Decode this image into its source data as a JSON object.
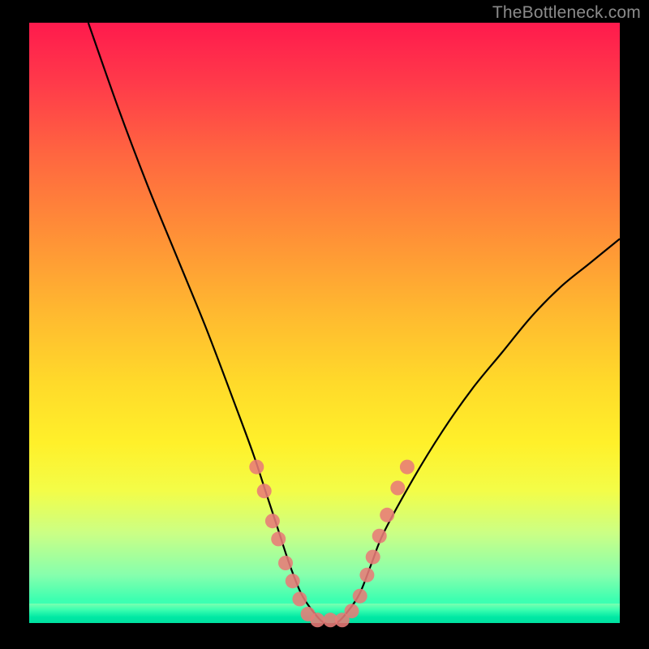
{
  "watermark": "TheBottleneck.com",
  "chart_data": {
    "type": "line",
    "title": "",
    "xlabel": "",
    "ylabel": "",
    "xlim": [
      0,
      100
    ],
    "ylim": [
      0,
      100
    ],
    "series": [
      {
        "name": "curve",
        "x": [
          10,
          15,
          20,
          25,
          30,
          35,
          38,
          40,
          42,
          44,
          46,
          48,
          50,
          52,
          54,
          56,
          58,
          60,
          65,
          70,
          75,
          80,
          85,
          90,
          95,
          100
        ],
        "y": [
          100,
          86,
          73,
          61,
          49,
          36,
          28,
          22,
          16,
          10,
          5,
          2,
          0,
          0,
          2,
          5,
          10,
          15,
          24,
          32,
          39,
          45,
          51,
          56,
          60,
          64
        ]
      }
    ],
    "markers": [
      {
        "x": 38.5,
        "y": 26
      },
      {
        "x": 39.8,
        "y": 22
      },
      {
        "x": 41.2,
        "y": 17
      },
      {
        "x": 42.2,
        "y": 14
      },
      {
        "x": 43.4,
        "y": 10
      },
      {
        "x": 44.6,
        "y": 7
      },
      {
        "x": 45.8,
        "y": 4
      },
      {
        "x": 47.2,
        "y": 1.5
      },
      {
        "x": 48.8,
        "y": 0.5
      },
      {
        "x": 51.0,
        "y": 0.5
      },
      {
        "x": 53.0,
        "y": 0.5
      },
      {
        "x": 54.6,
        "y": 2
      },
      {
        "x": 56.0,
        "y": 4.5
      },
      {
        "x": 57.2,
        "y": 8
      },
      {
        "x": 58.2,
        "y": 11
      },
      {
        "x": 59.3,
        "y": 14.5
      },
      {
        "x": 60.6,
        "y": 18
      },
      {
        "x": 62.4,
        "y": 22.5
      },
      {
        "x": 64.0,
        "y": 26
      }
    ],
    "gradient_stops": [
      {
        "pos": 0,
        "color": "#ff1a4d"
      },
      {
        "pos": 50,
        "color": "#ffda2a"
      },
      {
        "pos": 100,
        "color": "#2fffbf"
      }
    ]
  }
}
